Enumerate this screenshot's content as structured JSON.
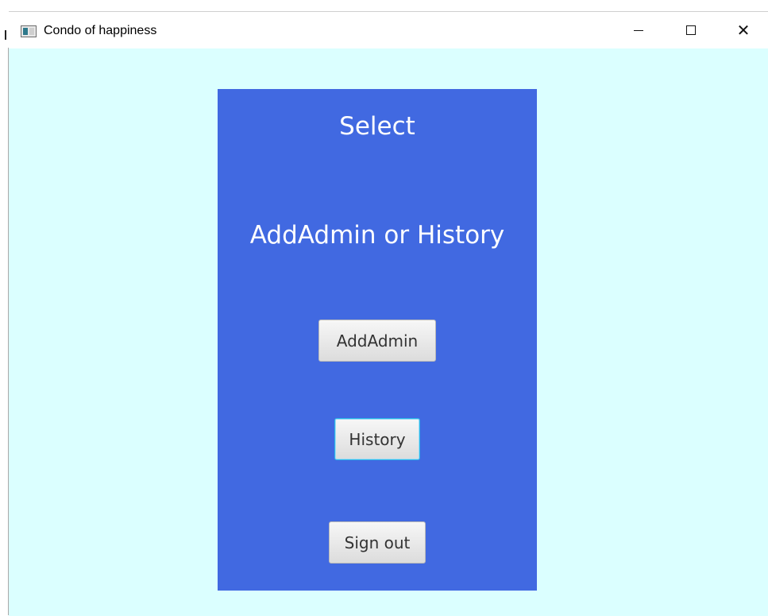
{
  "window": {
    "title": "Condo of happiness"
  },
  "panel": {
    "heading": "Select",
    "subheading": "AddAdmin or History",
    "background_color": "#4169e1"
  },
  "buttons": {
    "add_admin": "AddAdmin",
    "history": "History",
    "sign_out": "Sign out"
  },
  "colors": {
    "client_background": "#dbffff"
  }
}
